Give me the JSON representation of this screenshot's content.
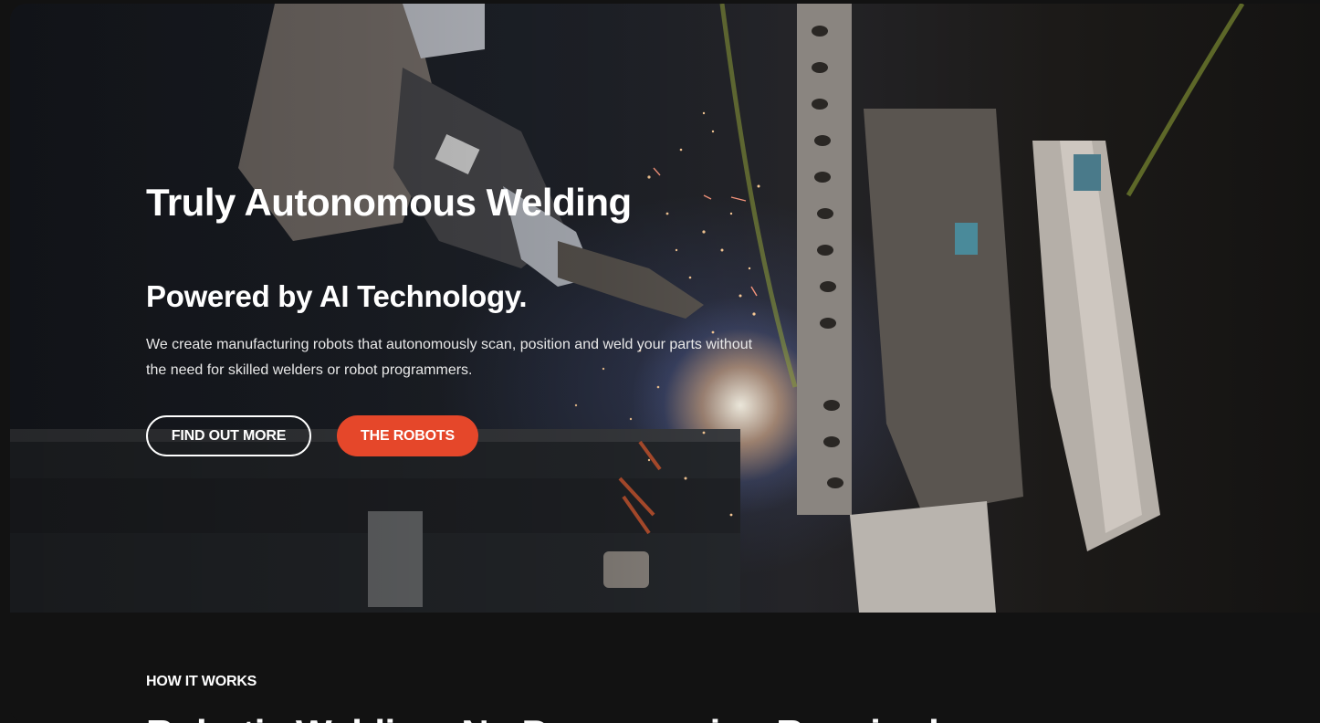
{
  "hero": {
    "title": "Truly Autonomous Welding",
    "subtitle": "Powered by AI Technology.",
    "description": "We create manufacturing robots that autonomously scan, position and weld your parts without the need for skilled welders or robot programmers.",
    "buttons": {
      "find_out_more": "FIND OUT MORE",
      "the_robots": "THE ROBOTS"
    },
    "accent_color": "#e5472a"
  },
  "how_it_works": {
    "eyebrow": "HOW IT WORKS",
    "heading": "Robotic Welding, No Programming Required"
  }
}
